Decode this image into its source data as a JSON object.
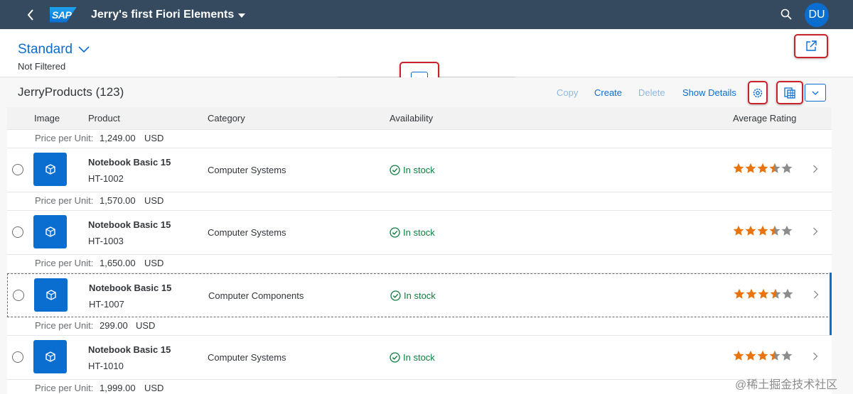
{
  "shell": {
    "logo_text": "SAP",
    "app_title": "Jerry's first Fiori Elements",
    "avatar_initials": "DU"
  },
  "header": {
    "variant": "Standard",
    "filter_status": "Not Filtered"
  },
  "toolbar": {
    "title": "JerryProducts (123)",
    "copy": "Copy",
    "create": "Create",
    "delete": "Delete",
    "show_details": "Show Details"
  },
  "table": {
    "columns": [
      "Image",
      "Product",
      "Category",
      "Availability",
      "Average Rating"
    ],
    "price_label": "Price per Unit:",
    "first_price": {
      "value": "1,249.00",
      "currency": "USD"
    },
    "rows": [
      {
        "name": "Notebook Basic 15",
        "id": "HT-1002",
        "category": "Computer Systems",
        "availability": "In stock",
        "rating": 3.5,
        "price": "1,570.00",
        "currency": "USD"
      },
      {
        "name": "Notebook Basic 15",
        "id": "HT-1003",
        "category": "Computer Systems",
        "availability": "In stock",
        "rating": 3.5,
        "price": "1,650.00",
        "currency": "USD"
      },
      {
        "name": "Notebook Basic 15",
        "id": "HT-1007",
        "category": "Computer Components",
        "availability": "In stock",
        "rating": 3.5,
        "price": "299.00",
        "currency": "USD"
      },
      {
        "name": "Notebook Basic 15",
        "id": "HT-1010",
        "category": "Computer Systems",
        "availability": "In stock",
        "rating": 3.5,
        "price": "1,999.00",
        "currency": "USD"
      }
    ]
  },
  "colors": {
    "shell_bg": "#354a5f",
    "accent": "#0a6ed1",
    "success": "#107e3e",
    "star": "#e9730c",
    "highlight_border": "#c9222a"
  },
  "watermark": "@稀土掘金技术社区"
}
